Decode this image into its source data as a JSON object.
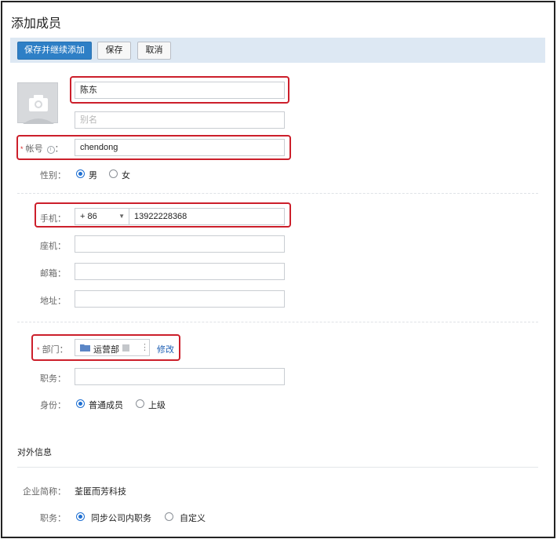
{
  "page": {
    "title": "添加成员"
  },
  "toolbar": {
    "save_continue": "保存并继续添加",
    "save": "保存",
    "cancel": "取消"
  },
  "profile": {
    "name": "陈东",
    "alias_placeholder": "别名",
    "account_label": "帐号",
    "account_value": "chendong",
    "gender_label": "性别：",
    "gender_options": [
      "男",
      "女"
    ],
    "gender_selected": "男"
  },
  "contact": {
    "mobile_label": "手机：",
    "country_code": "+ 86",
    "mobile_value": "13922228368",
    "landline_label": "座机：",
    "email_label": "邮箱：",
    "address_label": "地址："
  },
  "org": {
    "dept_label": "部门：",
    "dept_value": "运营部",
    "dept_edit": "修改",
    "position_label": "职务：",
    "identity_label": "身份：",
    "identity_options": [
      "普通成员",
      "上级"
    ],
    "identity_selected": "普通成员"
  },
  "external": {
    "section_title": "对外信息",
    "company_label": "企业简称：",
    "company_value": "荃匿而芳科技",
    "position_label": "职务：",
    "position_options": [
      "同步公司内职务",
      "自定义"
    ],
    "position_selected": "同步公司内职务"
  },
  "colors": {
    "primary": "#2e7fc6",
    "highlight": "#cc1f2b",
    "link": "#1e5fb4",
    "toolbar_bg": "#dde8f3"
  }
}
